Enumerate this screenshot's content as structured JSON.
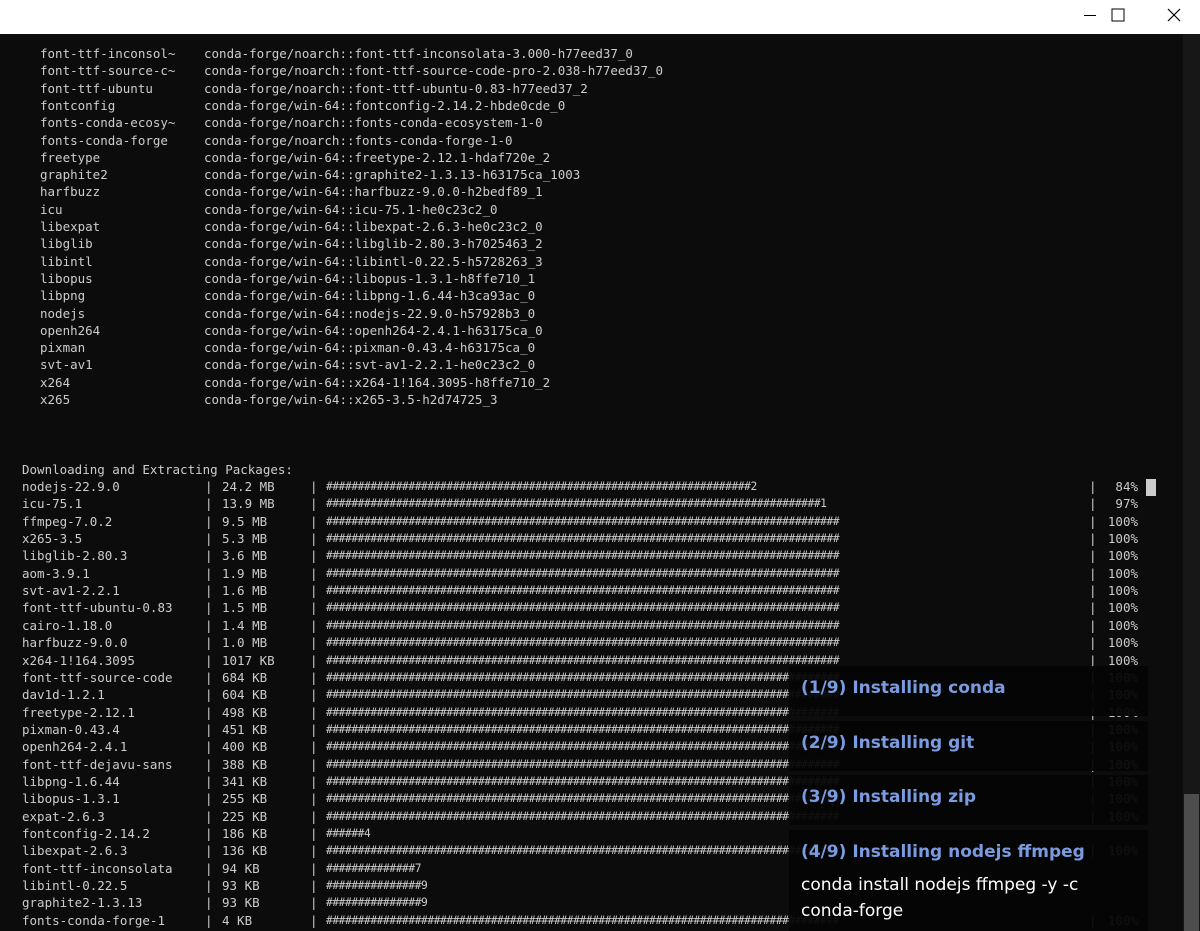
{
  "window": {
    "controls": [
      "minimize",
      "maximize",
      "close"
    ]
  },
  "packages": [
    {
      "name": "font-ttf-inconsol~",
      "spec": "conda-forge/noarch::font-ttf-inconsolata-3.000-h77eed37_0"
    },
    {
      "name": "font-ttf-source-c~",
      "spec": "conda-forge/noarch::font-ttf-source-code-pro-2.038-h77eed37_0"
    },
    {
      "name": "font-ttf-ubuntu",
      "spec": "conda-forge/noarch::font-ttf-ubuntu-0.83-h77eed37_2"
    },
    {
      "name": "fontconfig",
      "spec": "conda-forge/win-64::fontconfig-2.14.2-hbde0cde_0"
    },
    {
      "name": "fonts-conda-ecosy~",
      "spec": "conda-forge/noarch::fonts-conda-ecosystem-1-0"
    },
    {
      "name": "fonts-conda-forge",
      "spec": "conda-forge/noarch::fonts-conda-forge-1-0"
    },
    {
      "name": "freetype",
      "spec": "conda-forge/win-64::freetype-2.12.1-hdaf720e_2"
    },
    {
      "name": "graphite2",
      "spec": "conda-forge/win-64::graphite2-1.3.13-h63175ca_1003"
    },
    {
      "name": "harfbuzz",
      "spec": "conda-forge/win-64::harfbuzz-9.0.0-h2bedf89_1"
    },
    {
      "name": "icu",
      "spec": "conda-forge/win-64::icu-75.1-he0c23c2_0"
    },
    {
      "name": "libexpat",
      "spec": "conda-forge/win-64::libexpat-2.6.3-he0c23c2_0"
    },
    {
      "name": "libglib",
      "spec": "conda-forge/win-64::libglib-2.80.3-h7025463_2"
    },
    {
      "name": "libintl",
      "spec": "conda-forge/win-64::libintl-0.22.5-h5728263_3"
    },
    {
      "name": "libopus",
      "spec": "conda-forge/win-64::libopus-1.3.1-h8ffe710_1"
    },
    {
      "name": "libpng",
      "spec": "conda-forge/win-64::libpng-1.6.44-h3ca93ac_0"
    },
    {
      "name": "nodejs",
      "spec": "conda-forge/win-64::nodejs-22.9.0-h57928b3_0"
    },
    {
      "name": "openh264",
      "spec": "conda-forge/win-64::openh264-2.4.1-h63175ca_0"
    },
    {
      "name": "pixman",
      "spec": "conda-forge/win-64::pixman-0.43.4-h63175ca_0"
    },
    {
      "name": "svt-av1",
      "spec": "conda-forge/win-64::svt-av1-2.2.1-he0c23c2_0"
    },
    {
      "name": "x264",
      "spec": "conda-forge/win-64::x264-1!164.3095-h8ffe710_2"
    },
    {
      "name": "x265",
      "spec": "conda-forge/win-64::x265-3.5-h2d74725_3"
    }
  ],
  "download_header": "Downloading and Extracting Packages:",
  "downloads": [
    {
      "name": "nodejs-22.9.0",
      "size": "24.2 MB",
      "bar": "###################################################################2",
      "pct": "84%"
    },
    {
      "name": "icu-75.1",
      "size": "13.9 MB",
      "bar": "##############################################################################1",
      "pct": "97%"
    },
    {
      "name": "ffmpeg-7.0.2",
      "size": "9.5 MB",
      "bar": "#################################################################################",
      "pct": "100%"
    },
    {
      "name": "x265-3.5",
      "size": "5.3 MB",
      "bar": "#################################################################################",
      "pct": "100%"
    },
    {
      "name": "libglib-2.80.3",
      "size": "3.6 MB",
      "bar": "#################################################################################",
      "pct": "100%"
    },
    {
      "name": "aom-3.9.1",
      "size": "1.9 MB",
      "bar": "#################################################################################",
      "pct": "100%"
    },
    {
      "name": "svt-av1-2.2.1",
      "size": "1.6 MB",
      "bar": "#################################################################################",
      "pct": "100%"
    },
    {
      "name": "font-ttf-ubuntu-0.83",
      "size": "1.5 MB",
      "bar": "#################################################################################",
      "pct": "100%"
    },
    {
      "name": "cairo-1.18.0",
      "size": "1.4 MB",
      "bar": "#################################################################################",
      "pct": "100%"
    },
    {
      "name": "harfbuzz-9.0.0",
      "size": "1.0 MB",
      "bar": "#################################################################################",
      "pct": "100%"
    },
    {
      "name": "x264-1!164.3095",
      "size": "1017 KB",
      "bar": "#################################################################################",
      "pct": "100%"
    },
    {
      "name": "font-ttf-source-code",
      "size": "684 KB",
      "bar": "#################################################################################",
      "pct": "100%"
    },
    {
      "name": "dav1d-1.2.1",
      "size": "604 KB",
      "bar": "#################################################################################",
      "pct": "100%"
    },
    {
      "name": "freetype-2.12.1",
      "size": "498 KB",
      "bar": "#################################################################################",
      "pct": "100%"
    },
    {
      "name": "pixman-0.43.4",
      "size": "451 KB",
      "bar": "#################################################################################",
      "pct": "100%"
    },
    {
      "name": "openh264-2.4.1",
      "size": "400 KB",
      "bar": "#################################################################################",
      "pct": "100%"
    },
    {
      "name": "font-ttf-dejavu-sans",
      "size": "388 KB",
      "bar": "#################################################################################",
      "pct": "100%"
    },
    {
      "name": "libpng-1.6.44",
      "size": "341 KB",
      "bar": "#################################################################################",
      "pct": "100%"
    },
    {
      "name": "libopus-1.3.1",
      "size": "255 KB",
      "bar": "#################################################################################",
      "pct": "100%"
    },
    {
      "name": "expat-2.6.3",
      "size": "225 KB",
      "bar": "#################################################################################",
      "pct": "100%"
    },
    {
      "name": "fontconfig-2.14.2",
      "size": "186 KB",
      "bar": "######4",
      "pct": ""
    },
    {
      "name": "libexpat-2.6.3",
      "size": "136 KB",
      "bar": "#################################################################################",
      "pct": "100%"
    },
    {
      "name": "font-ttf-inconsolata",
      "size": "94 KB",
      "bar": "##############7",
      "pct": ""
    },
    {
      "name": "libintl-0.22.5",
      "size": "93 KB",
      "bar": "###############9",
      "pct": ""
    },
    {
      "name": "graphite2-1.3.13",
      "size": "93 KB",
      "bar": "###############9",
      "pct": ""
    },
    {
      "name": "fonts-conda-forge-1",
      "size": "4 KB",
      "bar": "#################################################################################",
      "pct": "100%"
    }
  ],
  "toasts": [
    {
      "title": "(1/9) Installing conda",
      "command": ""
    },
    {
      "title": "(2/9) Installing git",
      "command": ""
    },
    {
      "title": "(3/9) Installing zip",
      "command": ""
    },
    {
      "title": "(4/9) Installing nodejs ffmpeg",
      "command": "conda install nodejs ffmpeg -y -c conda-forge"
    }
  ]
}
